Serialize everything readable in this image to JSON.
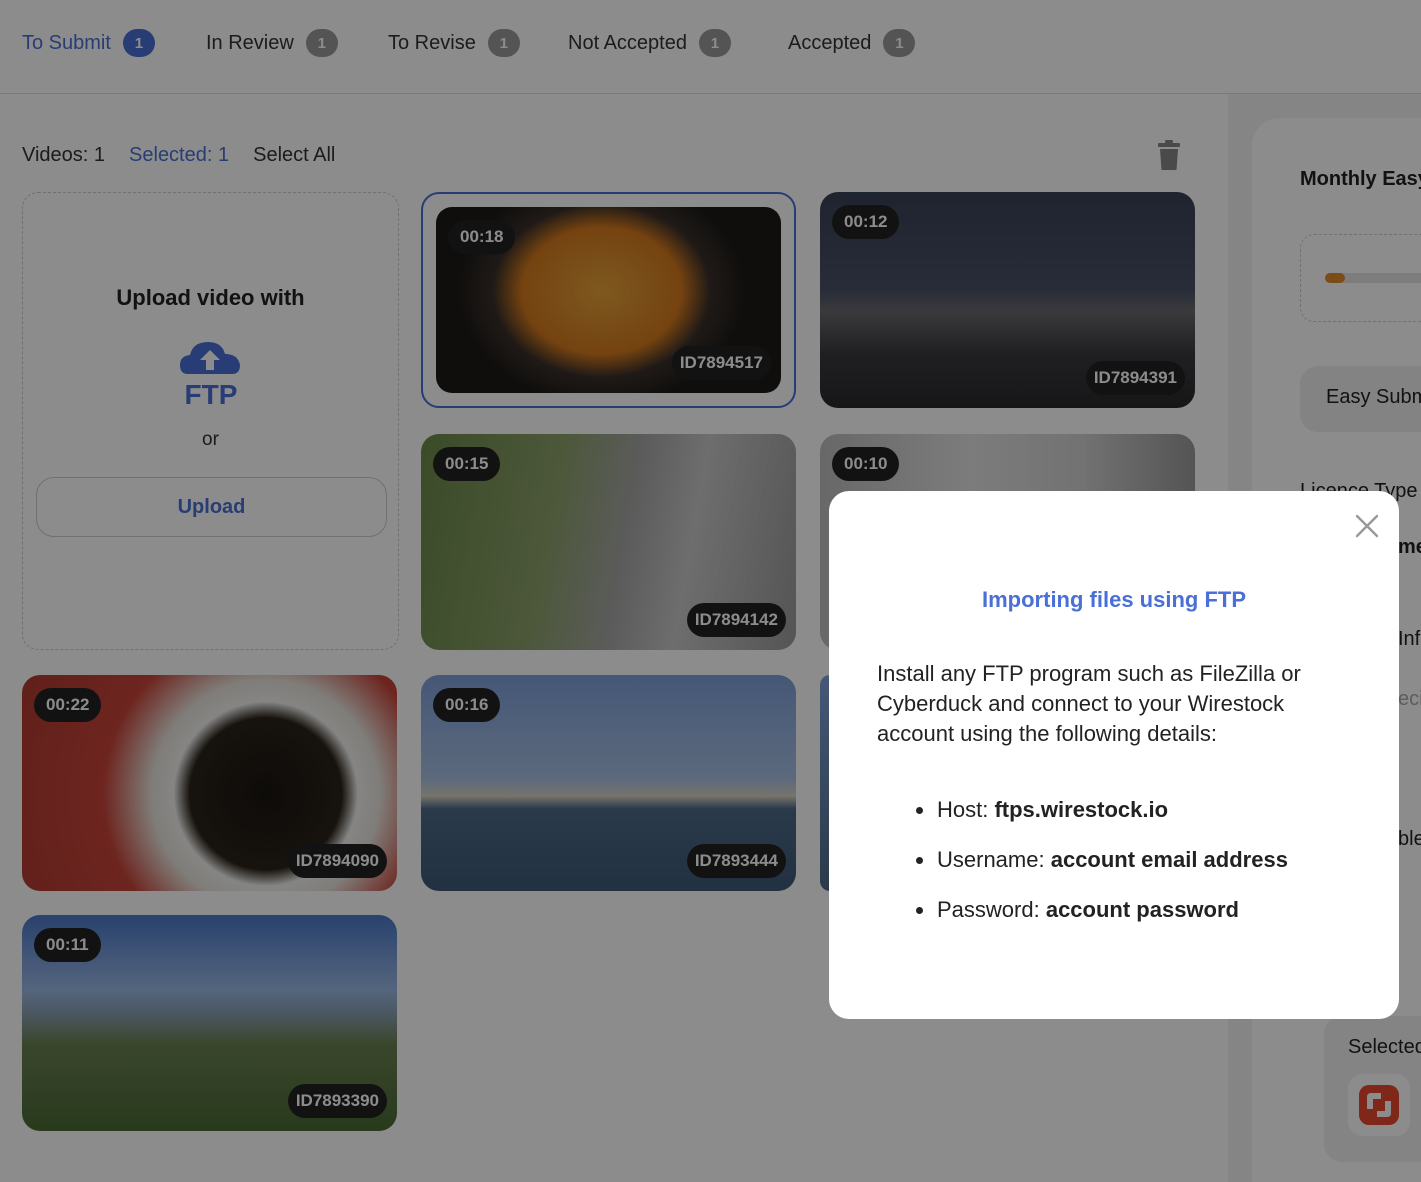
{
  "tabs": [
    {
      "label": "To Submit",
      "count": "1"
    },
    {
      "label": "In Review",
      "count": "1"
    },
    {
      "label": "To Revise",
      "count": "1"
    },
    {
      "label": "Not Accepted",
      "count": "1"
    },
    {
      "label": "Accepted",
      "count": "1"
    }
  ],
  "toolbar": {
    "videos": "Videos: 1",
    "selected": "Selected: 1",
    "select_all": "Select All"
  },
  "upload": {
    "title": "Upload video with",
    "ftp_label": "FTP",
    "or": "or",
    "button": "Upload"
  },
  "videos": [
    {
      "duration": "00:18",
      "id": "ID7894517",
      "selected": true
    },
    {
      "duration": "00:12",
      "id": "ID7894391"
    },
    {
      "duration": "00:15",
      "id": "ID7894142"
    },
    {
      "duration": "00:10",
      "id": ""
    },
    {
      "duration": "00:22",
      "id": "ID7894090"
    },
    {
      "duration": "00:16",
      "id": "ID7893444"
    },
    {
      "duration": "00:11",
      "id": "ID7893390"
    }
  ],
  "right_panel": {
    "monthly": "Monthly Easy",
    "easy_submit": "Easy Subm",
    "licence_type": "Licence Type",
    "licence_value": "me",
    "inf": "Inf",
    "eci": "eci",
    "ble": "ble",
    "selected": "Selected"
  },
  "modal": {
    "title": "Importing files using FTP",
    "intro": "Install any FTP program such as FileZilla or Cyberduck and connect to your Wirestock account using the following details:",
    "details": [
      {
        "label": "Host: ",
        "value": "ftps.wirestock.io"
      },
      {
        "label": "Username: ",
        "value": "account email address"
      },
      {
        "label": "Password: ",
        "value": "account password"
      }
    ]
  },
  "colors": {
    "accent": "#4a6fd6",
    "badge": "#999999",
    "overlay": "rgba(0,0,0,0.45)"
  }
}
